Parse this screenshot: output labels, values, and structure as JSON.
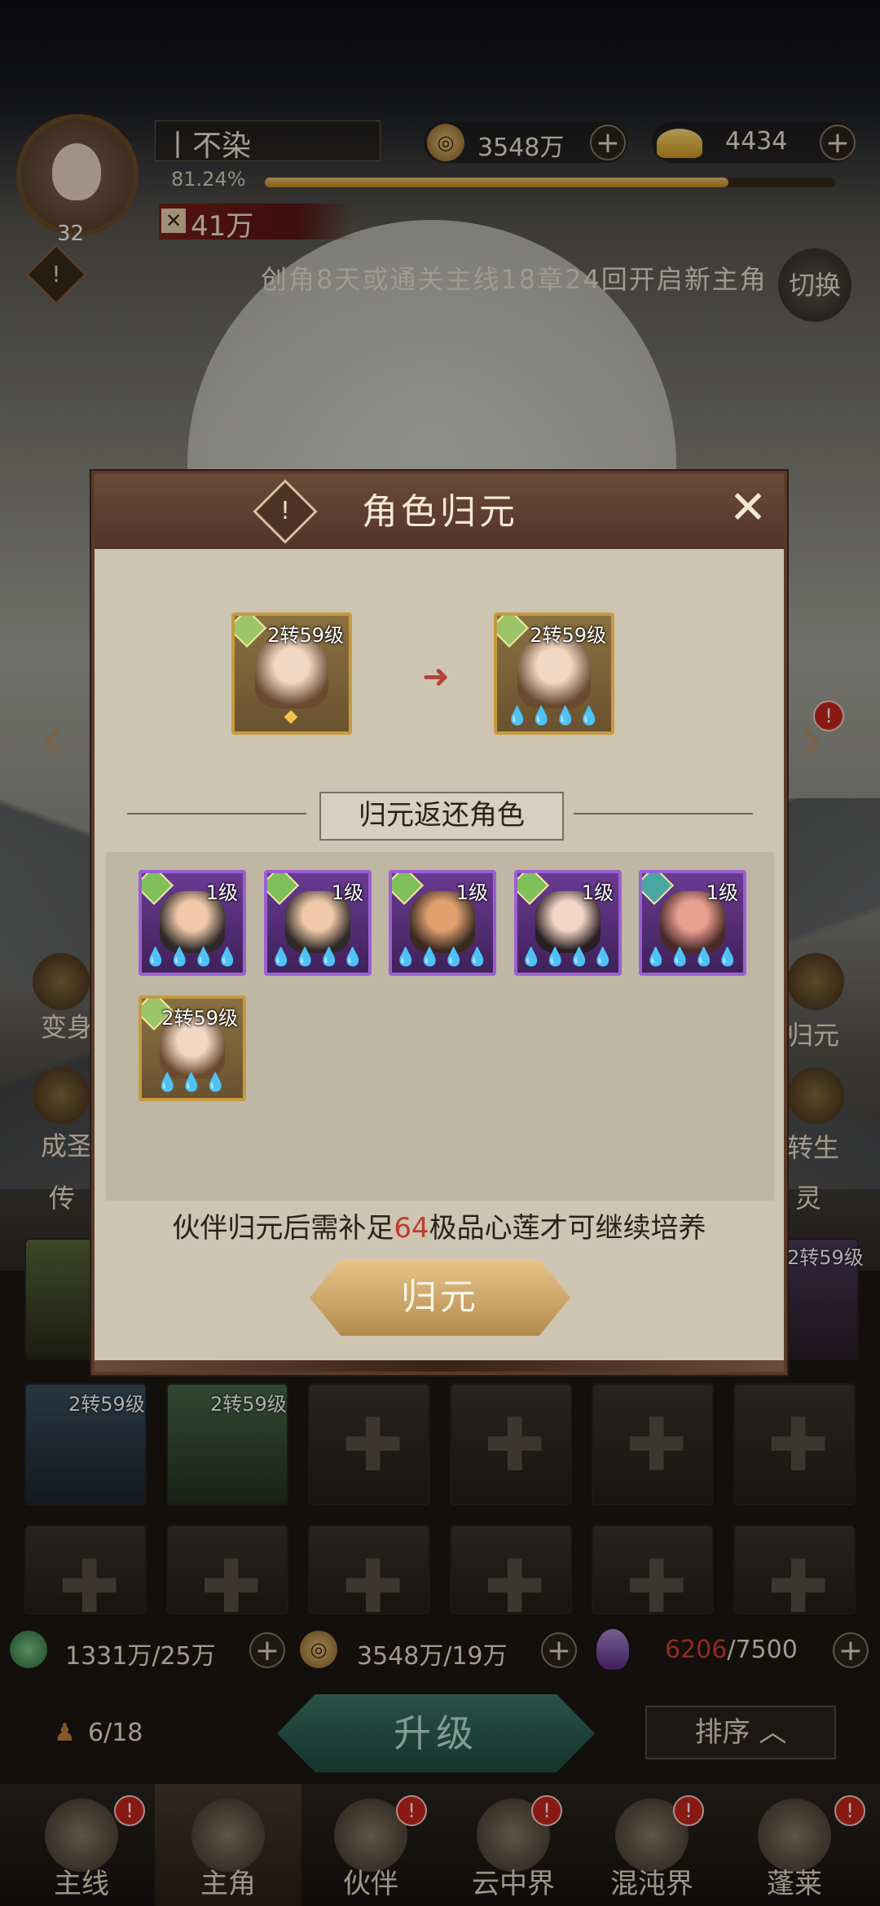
{
  "player": {
    "name": "丨不染",
    "level": "32",
    "exp_percent": "81.24%",
    "exp_fraction": 0.8124,
    "power": "41万"
  },
  "resources": {
    "coins": "3548万",
    "ingots": "4434"
  },
  "tip": "创角8天或通关主线18章24回开启新主角",
  "switch_label": "切换",
  "side": {
    "transform": "变身",
    "ascend": "成圣",
    "guiyuan": "归元",
    "rebirth": "转生",
    "legend": "传",
    "spirit": "灵"
  },
  "modal": {
    "title": "角色归元",
    "from_card": {
      "level": "2转59级"
    },
    "to_card": {
      "level": "2转59级",
      "drops": "💧💧💧💧"
    },
    "section_title": "归元返还角色",
    "returns": [
      {
        "level": "1级",
        "drops": "💧💧💧💧"
      },
      {
        "level": "1级",
        "drops": "💧💧💧💧"
      },
      {
        "level": "1级",
        "drops": "💧💧💧💧"
      },
      {
        "level": "1级",
        "drops": "💧💧💧💧"
      },
      {
        "level": "1级",
        "drops": "💧💧💧💧"
      },
      {
        "level": "2转59级",
        "drops": "💧💧💧"
      }
    ],
    "note_prefix": "伙伴归元后需补足",
    "note_number": "64",
    "note_suffix": "极品心莲才可继续培养",
    "confirm_label": "归元"
  },
  "roster": {
    "slot1": "2转59级",
    "slot2": "2转59级",
    "right": "2转59级"
  },
  "bottom_resources": {
    "jade": "1331万/25万",
    "coins": "3548万/19万",
    "crystal_current": "6206",
    "crystal_max": "/7500"
  },
  "party_count": "6/18",
  "upgrade_label": "升级",
  "sort_label": "排序",
  "tabs": [
    "主线",
    "主角",
    "伙伴",
    "云中界",
    "混沌界",
    "蓬莱"
  ],
  "colors": {
    "accent_red": "#c03c30",
    "card_purple": "#9b5fd1",
    "card_gold": "#c69b3e"
  }
}
